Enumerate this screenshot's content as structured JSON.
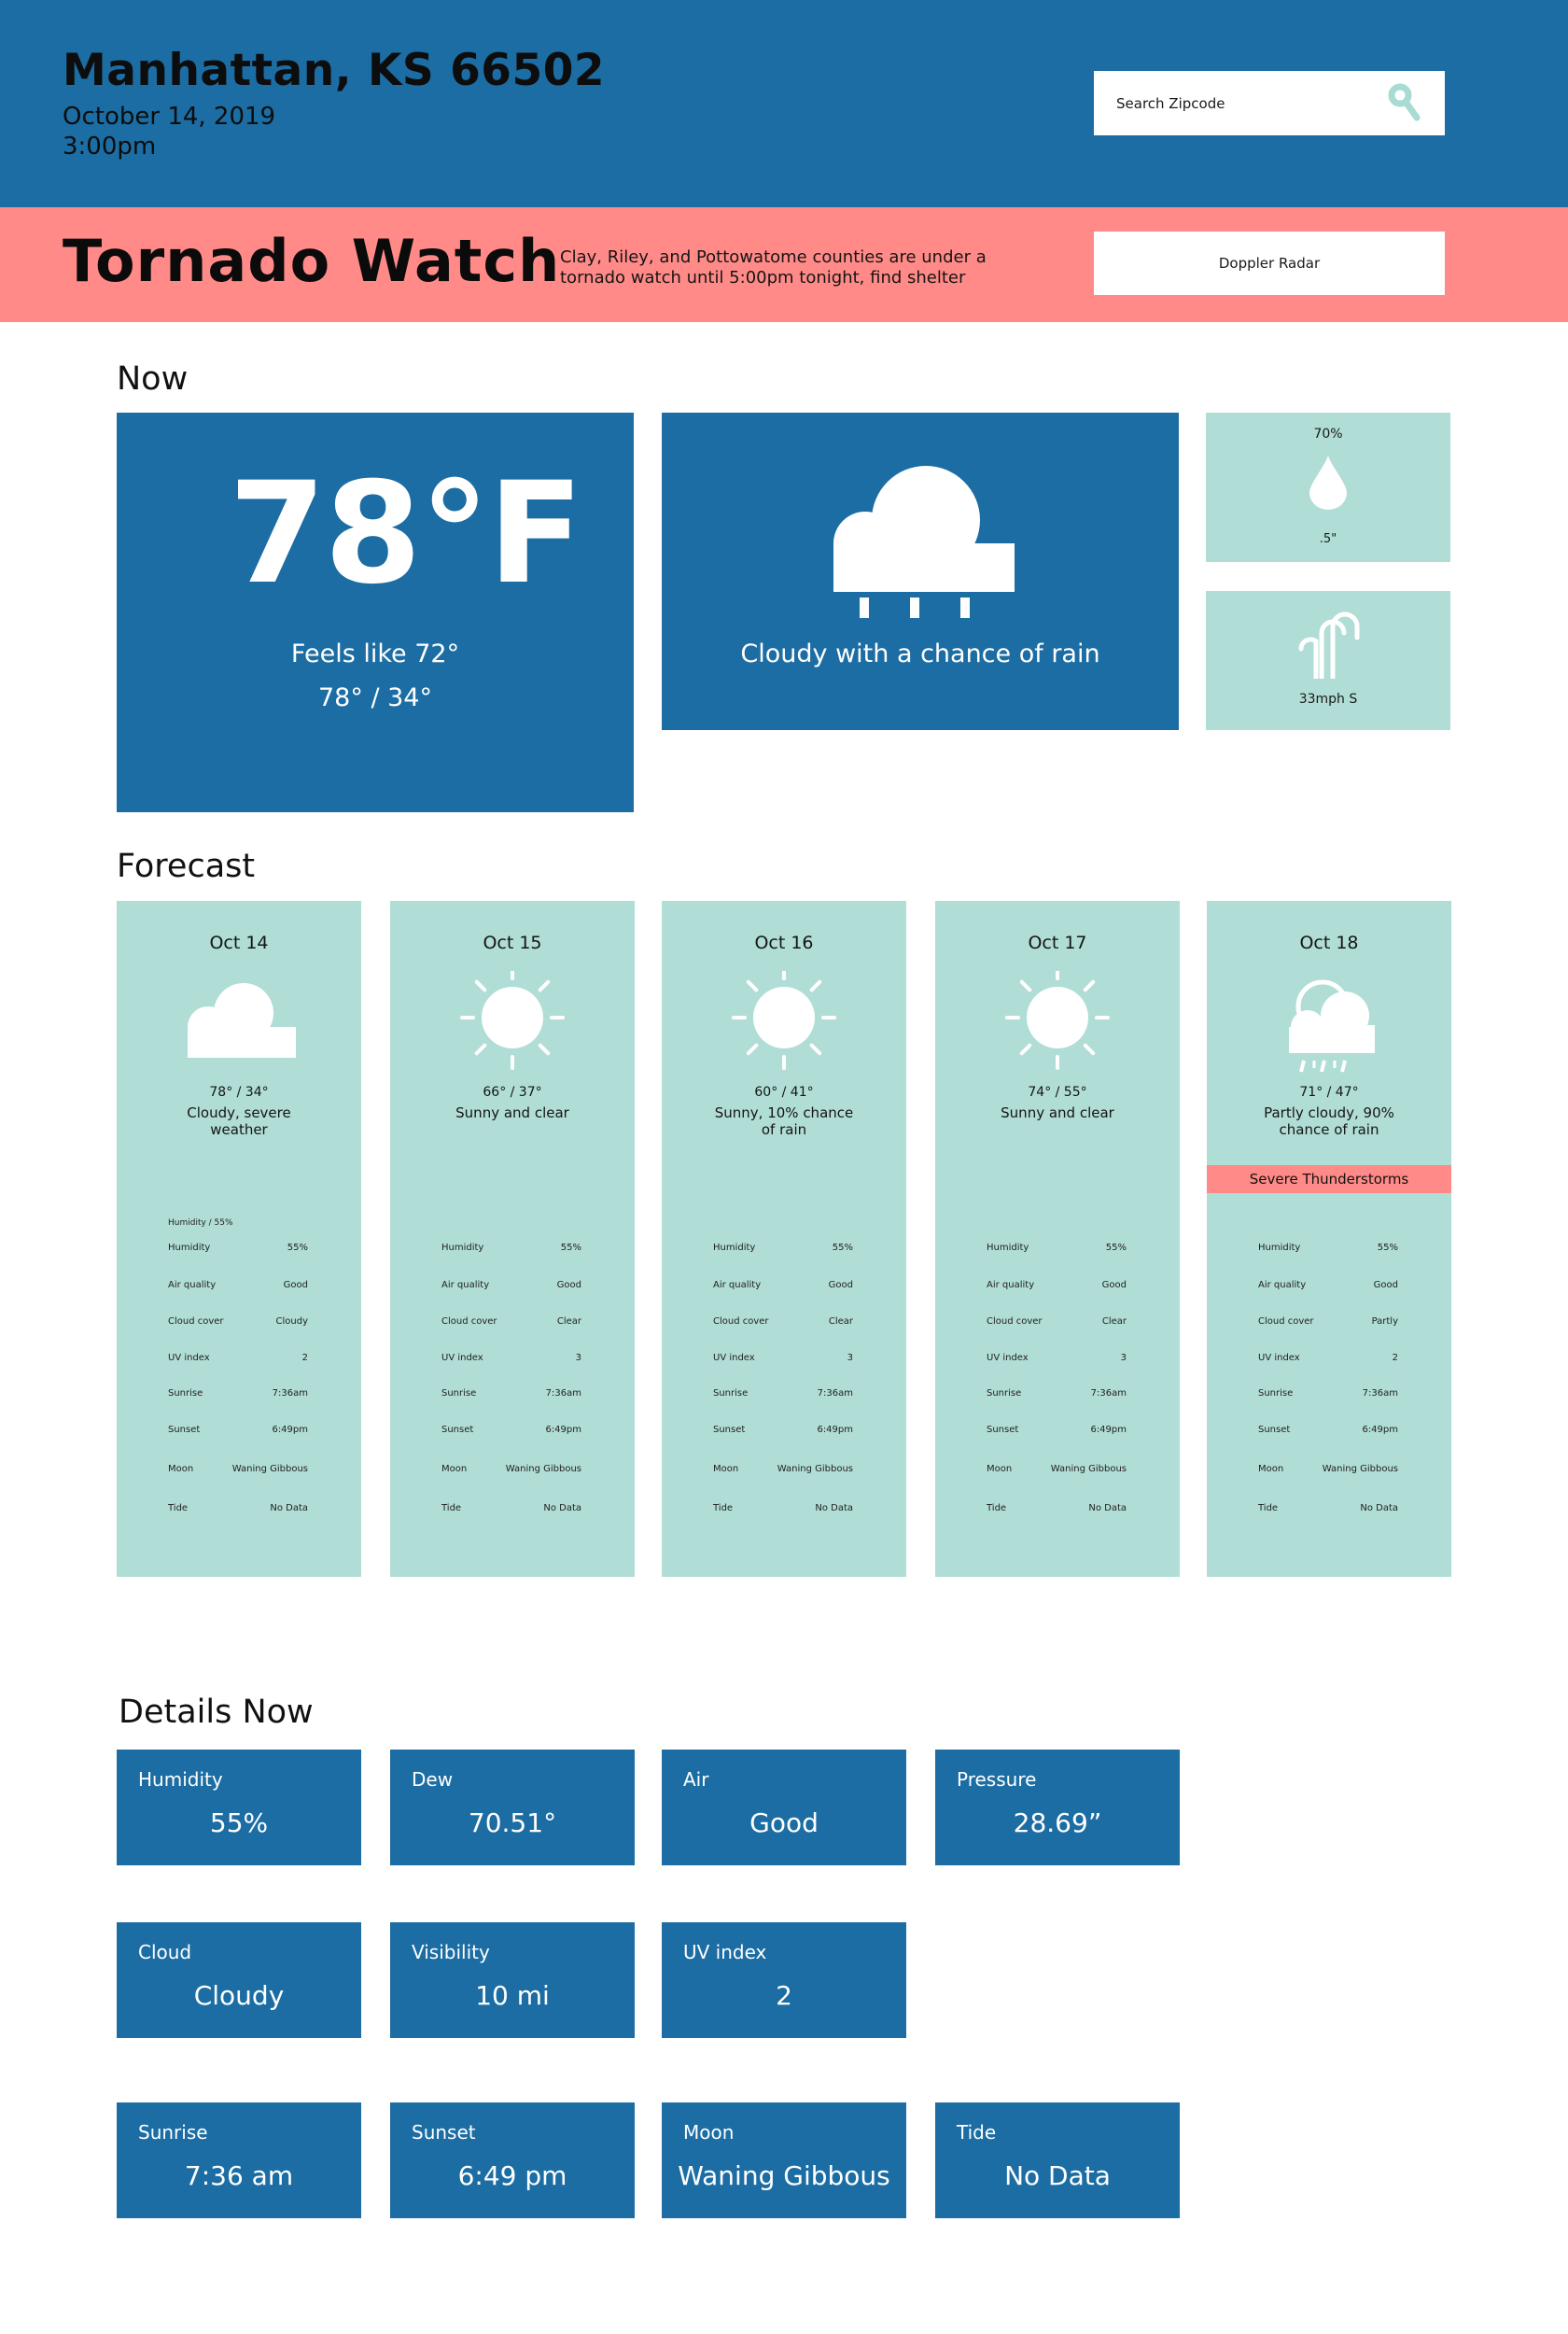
{
  "header": {
    "location": "Manhattan, KS 66502",
    "date": "October 14, 2019",
    "time": "3:00pm",
    "search_placeholder": "Search Zipcode"
  },
  "alert": {
    "title": "Tornado Watch",
    "message": "Clay, Riley, and Pottowatome counties are under a tornado watch until 5:00pm tonight, find shelter",
    "radar_button": "Doppler Radar"
  },
  "sections": {
    "now": "Now",
    "forecast": "Forecast",
    "details": "Details Now"
  },
  "now": {
    "temperature": "78°F",
    "feels_like": "Feels like 72°",
    "hi_lo": "78° / 34°",
    "condition": "Cloudy with a chance of rain",
    "precip_chance": "70%",
    "precip_amount": ".5\"",
    "wind": "33mph S",
    "icons": {
      "condition": "rain-cloud-icon",
      "precip": "raindrop-icon",
      "wind": "wind-icon"
    }
  },
  "forecast": [
    {
      "date": "Oct 14",
      "icon": "cloud-icon",
      "temps": "78° / 34°",
      "desc": "Cloudy, severe weather",
      "alert": "",
      "humidity_header": "Humidity / 55%",
      "rows": [
        [
          "Humidity",
          "55%"
        ],
        [
          "Air quality",
          "Good"
        ],
        [
          "Cloud cover",
          "Cloudy"
        ],
        [
          "UV index",
          "2"
        ],
        [
          "Sunrise",
          "7:36am"
        ],
        [
          "Sunset",
          "6:49pm"
        ],
        [
          "Moon",
          "Waning Gibbous"
        ],
        [
          "Tide",
          "No Data"
        ]
      ]
    },
    {
      "date": "Oct 15",
      "icon": "sun-icon",
      "temps": "66° / 37°",
      "desc": "Sunny and clear",
      "alert": "",
      "humidity_header": "",
      "rows": [
        [
          "Humidity",
          "55%"
        ],
        [
          "Air quality",
          "Good"
        ],
        [
          "Cloud cover",
          "Clear"
        ],
        [
          "UV index",
          "3"
        ],
        [
          "Sunrise",
          "7:36am"
        ],
        [
          "Sunset",
          "6:49pm"
        ],
        [
          "Moon",
          "Waning Gibbous"
        ],
        [
          "Tide",
          "No Data"
        ]
      ]
    },
    {
      "date": "Oct 16",
      "icon": "sun-icon",
      "temps": "60° / 41°",
      "desc": "Sunny, 10% chance of rain",
      "alert": "",
      "humidity_header": "",
      "rows": [
        [
          "Humidity",
          "55%"
        ],
        [
          "Air quality",
          "Good"
        ],
        [
          "Cloud cover",
          "Clear"
        ],
        [
          "UV index",
          "3"
        ],
        [
          "Sunrise",
          "7:36am"
        ],
        [
          "Sunset",
          "6:49pm"
        ],
        [
          "Moon",
          "Waning Gibbous"
        ],
        [
          "Tide",
          "No Data"
        ]
      ]
    },
    {
      "date": "Oct 17",
      "icon": "sun-icon",
      "temps": "74° / 55°",
      "desc": "Sunny and clear",
      "alert": "",
      "humidity_header": "",
      "rows": [
        [
          "Humidity",
          "55%"
        ],
        [
          "Air quality",
          "Good"
        ],
        [
          "Cloud cover",
          "Clear"
        ],
        [
          "UV index",
          "3"
        ],
        [
          "Sunrise",
          "7:36am"
        ],
        [
          "Sunset",
          "6:49pm"
        ],
        [
          "Moon",
          "Waning Gibbous"
        ],
        [
          "Tide",
          "No Data"
        ]
      ]
    },
    {
      "date": "Oct 18",
      "icon": "storm-cloud-icon",
      "temps": "71° / 47°",
      "desc": "Partly cloudy, 90% chance of rain",
      "alert": "Severe Thunderstorms",
      "humidity_header": "",
      "rows": [
        [
          "Humidity",
          "55%"
        ],
        [
          "Air quality",
          "Good"
        ],
        [
          "Cloud cover",
          "Partly"
        ],
        [
          "UV index",
          "2"
        ],
        [
          "Sunrise",
          "7:36am"
        ],
        [
          "Sunset",
          "6:49pm"
        ],
        [
          "Moon",
          "Waning Gibbous"
        ],
        [
          "Tide",
          "No Data"
        ]
      ]
    }
  ],
  "details": [
    [
      {
        "label": "Humidity",
        "value": "55%"
      },
      {
        "label": "Dew",
        "value": "70.51°"
      },
      {
        "label": "Air",
        "value": "Good"
      },
      {
        "label": "Pressure",
        "value": "28.69”"
      }
    ],
    [
      {
        "label": "Cloud",
        "value": "Cloudy"
      },
      {
        "label": "Visibility",
        "value": "10 mi"
      },
      {
        "label": "UV index",
        "value": "2"
      }
    ],
    [
      {
        "label": "Sunrise",
        "value": "7:36 am"
      },
      {
        "label": "Sunset",
        "value": "6:49 pm"
      },
      {
        "label": "Moon",
        "value": "Waning Gibbous"
      },
      {
        "label": "Tide",
        "value": "No Data"
      }
    ]
  ],
  "colors": {
    "primary_blue": "#1c6da3",
    "alert_coral": "#ff8a87",
    "mint": "#b0ddd5",
    "icon_mint": "#a8dbd3"
  }
}
